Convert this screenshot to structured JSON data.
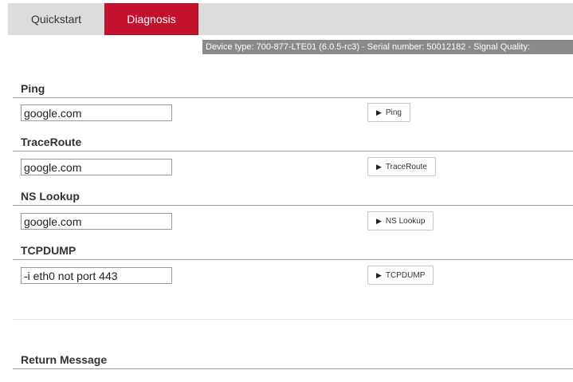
{
  "tabs": {
    "quickstart": "Quickstart",
    "diagnosis": "Diagnosis"
  },
  "device_info": "Device type: 700-877-LTE01 (6.0.5-rc3) - Serial number: 50012182  - Signal Quality:",
  "sections": {
    "ping": {
      "title": "Ping",
      "input_value": "google.com",
      "button_label": "Ping"
    },
    "traceroute": {
      "title": "TraceRoute",
      "input_value": "google.com",
      "button_label": "TraceRoute"
    },
    "nslookup": {
      "title": "NS Lookup",
      "input_value": "google.com",
      "button_label": "NS Lookup"
    },
    "tcpdump": {
      "title": "TCPDUMP",
      "input_value": "-i eth0 not port 443",
      "button_label": "TCPDUMP"
    }
  },
  "return_message": {
    "title": "Return Message"
  },
  "icons": {
    "run": "play-icon"
  },
  "colors": {
    "active_tab": "#c4122e",
    "tab_bar": "#dcdcdc",
    "info_strip": "#8a8a8a"
  }
}
